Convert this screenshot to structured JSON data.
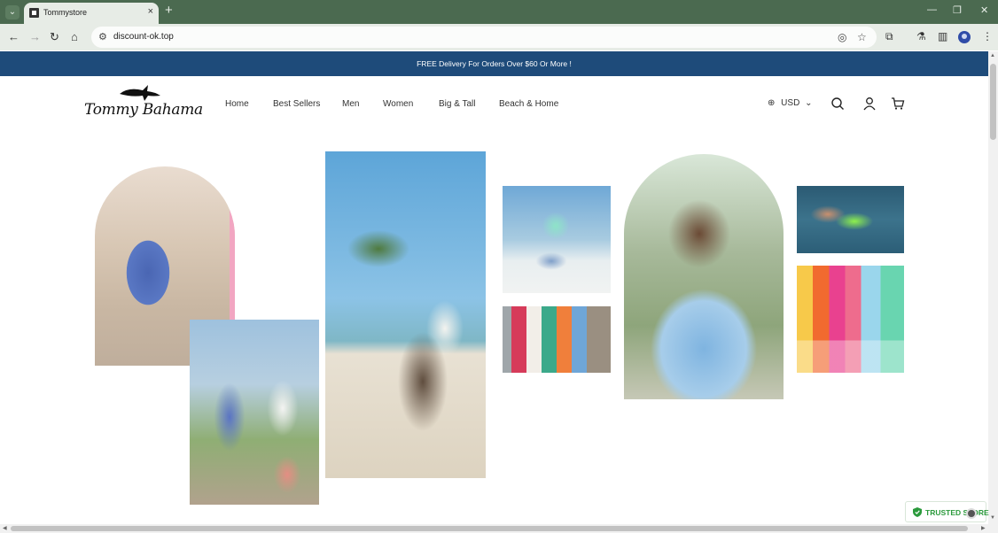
{
  "browser": {
    "tab_title": "Tommystore",
    "url": "discount-ok.top",
    "new_tab_label": "+",
    "tab_close": "×"
  },
  "announcement": "FREE Delivery For Orders Over $60 Or More !",
  "logo": {
    "text": "Tommy Bahama"
  },
  "nav": {
    "items": [
      "Home",
      "Best Sellers",
      "Men",
      "Women",
      "Big & Tall",
      "Beach & Home"
    ]
  },
  "currency": {
    "label": "USD"
  },
  "trusted_badge": {
    "label": "TRUSTED STORE",
    "color": "#2b9a3c"
  },
  "colors": {
    "announcement_bg": "#1e4b7a",
    "tabbar_bg": "#4b6a50",
    "toolbar_bg": "#e7ece6"
  },
  "hero_images": [
    {
      "name": "woman-blue-print-romper-arch"
    },
    {
      "name": "couple-street-palm"
    },
    {
      "name": "man-leaning-palm-tree-beach"
    },
    {
      "name": "man-seated-boat-mint-shirt"
    },
    {
      "name": "colorful-towels-rack"
    },
    {
      "name": "man-blue-floral-shirt-arch"
    },
    {
      "name": "man-float-water"
    },
    {
      "name": "colorful-shirts-stack"
    }
  ]
}
